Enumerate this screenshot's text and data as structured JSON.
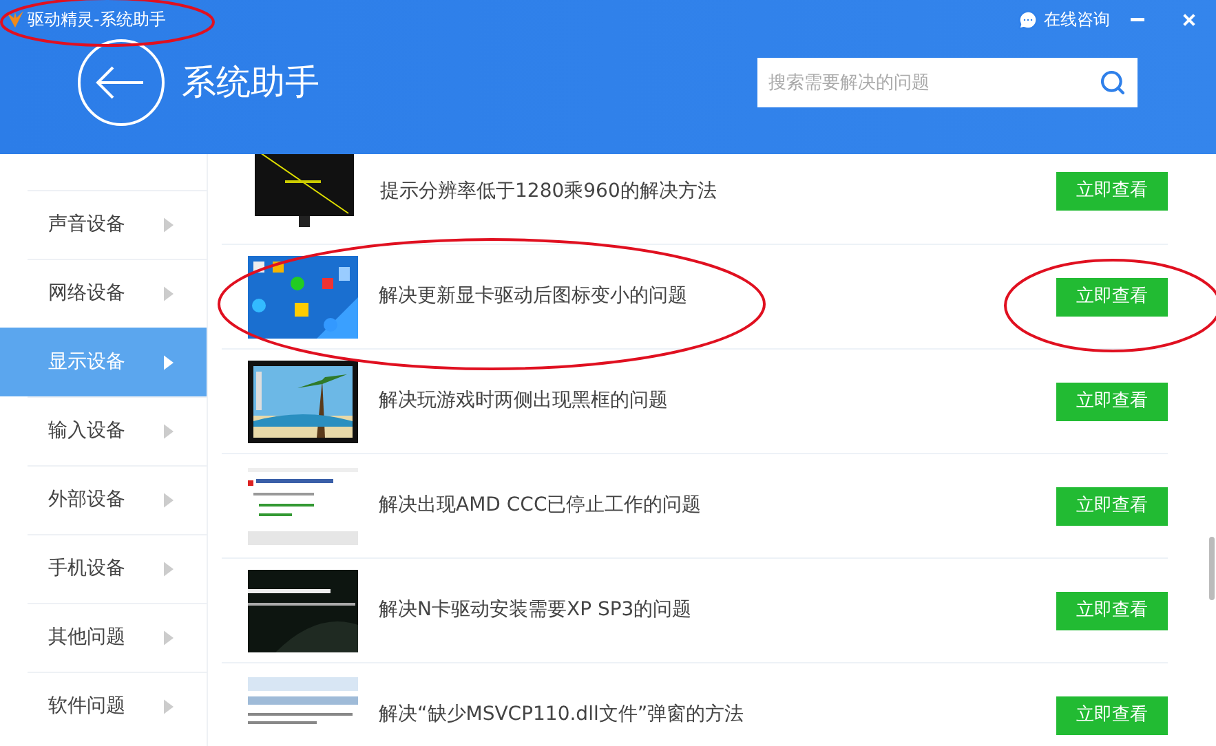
{
  "window": {
    "title": "驱动精灵-系统助手",
    "consult": "在线咨询"
  },
  "header": {
    "title": "系统助手",
    "search": {
      "placeholder": "搜索需要解决的问题"
    }
  },
  "sidebar": {
    "items": [
      {
        "label": "声音设备",
        "selected": false
      },
      {
        "label": "网络设备",
        "selected": false
      },
      {
        "label": "显示设备",
        "selected": true
      },
      {
        "label": "输入设备",
        "selected": false
      },
      {
        "label": "外部设备",
        "selected": false
      },
      {
        "label": "手机设备",
        "selected": false
      },
      {
        "label": "其他问题",
        "selected": false
      },
      {
        "label": "软件问题",
        "selected": false
      }
    ]
  },
  "articles": [
    {
      "title": "提示分辨率低于1280乘960的解决方法",
      "button": "立即查看"
    },
    {
      "title": "解决更新显卡驱动后图标变小的问题",
      "button": "立即查看"
    },
    {
      "title": "解决玩游戏时两侧出现黑框的问题",
      "button": "立即查看"
    },
    {
      "title": "解决出现AMD CCC已停止工作的问题",
      "button": "立即查看"
    },
    {
      "title": "解决N卡驱动安装需要XP SP3的问题",
      "button": "立即查看"
    },
    {
      "title": "解决“缺少MSVCP110.dll文件”弹窗的方法",
      "button": "立即查看"
    }
  ]
}
